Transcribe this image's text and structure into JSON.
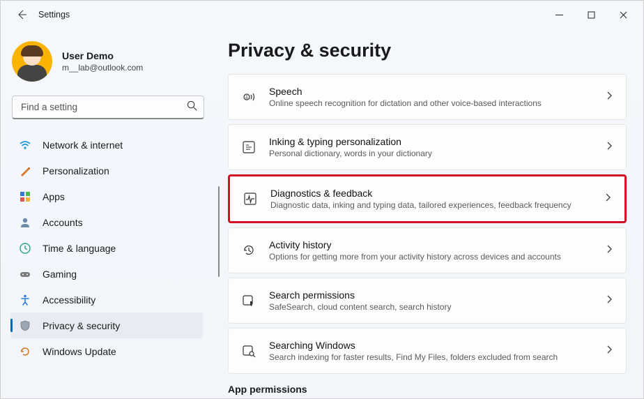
{
  "window": {
    "title": "Settings"
  },
  "profile": {
    "name": "User Demo",
    "email": "m__lab@outlook.com"
  },
  "search": {
    "placeholder": "Find a setting"
  },
  "sidebar": {
    "items": [
      {
        "label": "Network & internet"
      },
      {
        "label": "Personalization"
      },
      {
        "label": "Apps"
      },
      {
        "label": "Accounts"
      },
      {
        "label": "Time & language"
      },
      {
        "label": "Gaming"
      },
      {
        "label": "Accessibility"
      },
      {
        "label": "Privacy & security"
      },
      {
        "label": "Windows Update"
      }
    ]
  },
  "page": {
    "title": "Privacy & security",
    "section2": "App permissions"
  },
  "cards": [
    {
      "title": "Speech",
      "subtitle": "Online speech recognition for dictation and other voice-based interactions"
    },
    {
      "title": "Inking & typing personalization",
      "subtitle": "Personal dictionary, words in your dictionary"
    },
    {
      "title": "Diagnostics & feedback",
      "subtitle": "Diagnostic data, inking and typing data, tailored experiences, feedback frequency"
    },
    {
      "title": "Activity history",
      "subtitle": "Options for getting more from your activity history across devices and accounts"
    },
    {
      "title": "Search permissions",
      "subtitle": "SafeSearch, cloud content search, search history"
    },
    {
      "title": "Searching Windows",
      "subtitle": "Search indexing for faster results, Find My Files, folders excluded from search"
    }
  ]
}
